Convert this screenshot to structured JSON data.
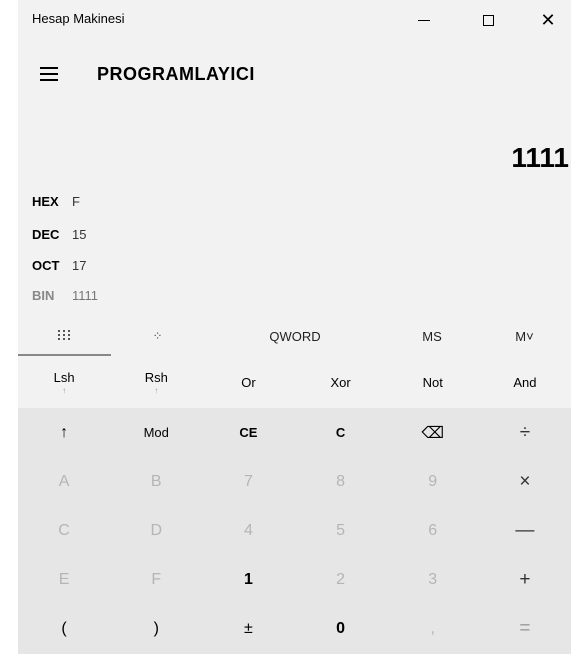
{
  "window": {
    "title": "Hesap Makinesi",
    "minimize": "—",
    "maximize": "☐",
    "close": "✕"
  },
  "header": {
    "mode_title": "PROGRAMLAYICI"
  },
  "display": {
    "value": "1111",
    "radix": [
      {
        "key": "HEX",
        "value": "F"
      },
      {
        "key": "DEC",
        "value": "15"
      },
      {
        "key": "OCT",
        "value": "17"
      },
      {
        "key": "BIN",
        "value": "1111"
      }
    ]
  },
  "tabs": {
    "word_size": "QWORD",
    "ms": "MS",
    "mlist": "M˅"
  },
  "logic": [
    {
      "label": "Lsh",
      "sub": "↑"
    },
    {
      "label": "Rsh",
      "sub": "↑"
    },
    {
      "label": "Or",
      "sub": ""
    },
    {
      "label": "Xor",
      "sub": ""
    },
    {
      "label": "Not",
      "sub": ""
    },
    {
      "label": "And",
      "sub": ""
    }
  ],
  "keys": [
    [
      "↑",
      "Mod",
      "CE",
      "C",
      "⌫",
      "÷"
    ],
    [
      "A",
      "B",
      "7",
      "8",
      "9",
      "×"
    ],
    [
      "C",
      "D",
      "4",
      "5",
      "6",
      "—"
    ],
    [
      "E",
      "F",
      "1",
      "2",
      "3",
      "+"
    ],
    [
      "(",
      ")",
      "±",
      "0",
      ",",
      "="
    ]
  ]
}
